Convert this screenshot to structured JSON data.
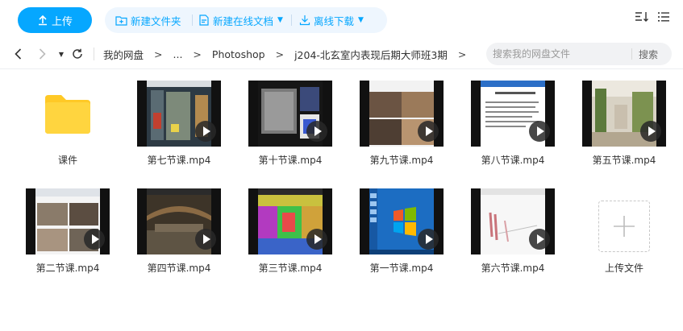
{
  "toolbar": {
    "upload_label": "上传",
    "new_folder_label": "新建文件夹",
    "new_online_doc_label": "新建在线文档",
    "offline_download_label": "离线下载"
  },
  "nav": {
    "breadcrumbs": [
      "我的网盘",
      "...",
      "Photoshop",
      "j204-北玄室内表现后期大师班3期"
    ],
    "separator": ">"
  },
  "search": {
    "placeholder": "搜索我的网盘文件",
    "button_label": "搜索"
  },
  "files": [
    {
      "name": "课件",
      "kind": "folder"
    },
    {
      "name": "第七节课.mp4",
      "kind": "video"
    },
    {
      "name": "第十节课.mp4",
      "kind": "video"
    },
    {
      "name": "第九节课.mp4",
      "kind": "video"
    },
    {
      "name": "第八节课.mp4",
      "kind": "video"
    },
    {
      "name": "第五节课.mp4",
      "kind": "video"
    },
    {
      "name": "第二节课.mp4",
      "kind": "video"
    },
    {
      "name": "第四节课.mp4",
      "kind": "video"
    },
    {
      "name": "第三节课.mp4",
      "kind": "video"
    },
    {
      "name": "第一节课.mp4",
      "kind": "video"
    },
    {
      "name": "第六节课.mp4",
      "kind": "video"
    },
    {
      "name": "上传文件",
      "kind": "upload"
    }
  ],
  "colors": {
    "accent": "#06a7ff",
    "folder": "#ffd53f",
    "toolbar_bg": "#eef6fe"
  }
}
